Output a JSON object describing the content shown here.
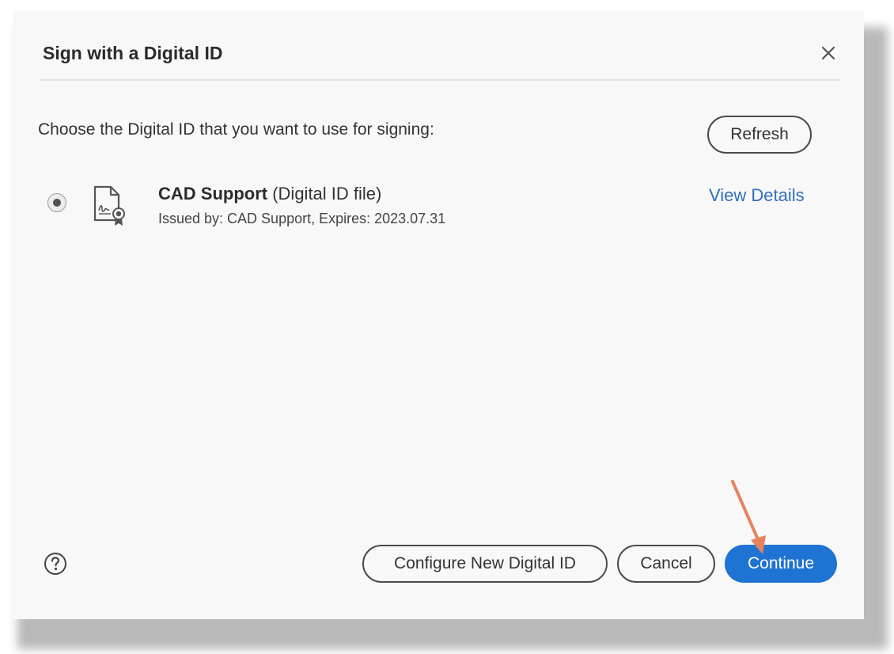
{
  "dialog": {
    "title": "Sign with a Digital ID",
    "close_icon": "close-icon"
  },
  "content": {
    "prompt": "Choose the Digital ID that you want to use for signing:",
    "refresh_label": "Refresh"
  },
  "digital_ids": [
    {
      "selected": true,
      "icon": "certificate-icon",
      "name": "CAD Support",
      "type": "(Digital ID file)",
      "issued": "Issued by: CAD Support, Expires: 2023.07.31",
      "view_details_label": "View Details"
    }
  ],
  "footer": {
    "help_icon": "help-icon",
    "configure_label": "Configure New Digital ID",
    "cancel_label": "Cancel",
    "continue_label": "Continue"
  },
  "colors": {
    "accent": "#1f73d2",
    "link": "#2f6fbd",
    "annotation_arrow": "#e8825c"
  }
}
